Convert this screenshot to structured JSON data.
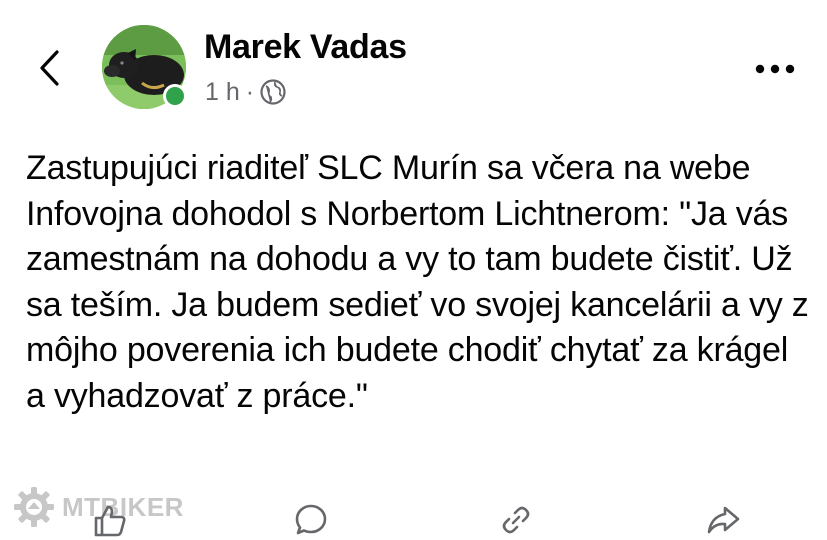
{
  "header": {
    "author_name": "Marek Vadas",
    "post_age": "1 h",
    "separator": "·",
    "audience_icon": "globe-icon",
    "online_status": "online",
    "back_icon": "chevron-left-icon",
    "more_icon": "more-horizontal-icon"
  },
  "post": {
    "text": "Zastupujúci riaditeľ SLC Murín sa včera na webe Infovojna dohodol s Norbertom Lichtnerom: \"Ja vás zamestnám na dohodu a vy to tam budete čistiť. Už sa teším. Ja budem sedieť vo svojej kancelárii a vy z môjho poverenia ich budete chodiť chytať za krágel a vyhadzovať z práce.\""
  },
  "watermark": {
    "text": "MTBIKER",
    "icon": "gear-logo-icon"
  },
  "actions": [
    {
      "name": "like",
      "icon": "thumbs-up-icon"
    },
    {
      "name": "comment",
      "icon": "comment-icon"
    },
    {
      "name": "copy-link",
      "icon": "link-icon"
    },
    {
      "name": "share",
      "icon": "share-icon"
    }
  ],
  "colors": {
    "text_primary": "#050505",
    "text_secondary": "#65676b",
    "online_green": "#31a24c",
    "icon_gray": "#65676b"
  }
}
